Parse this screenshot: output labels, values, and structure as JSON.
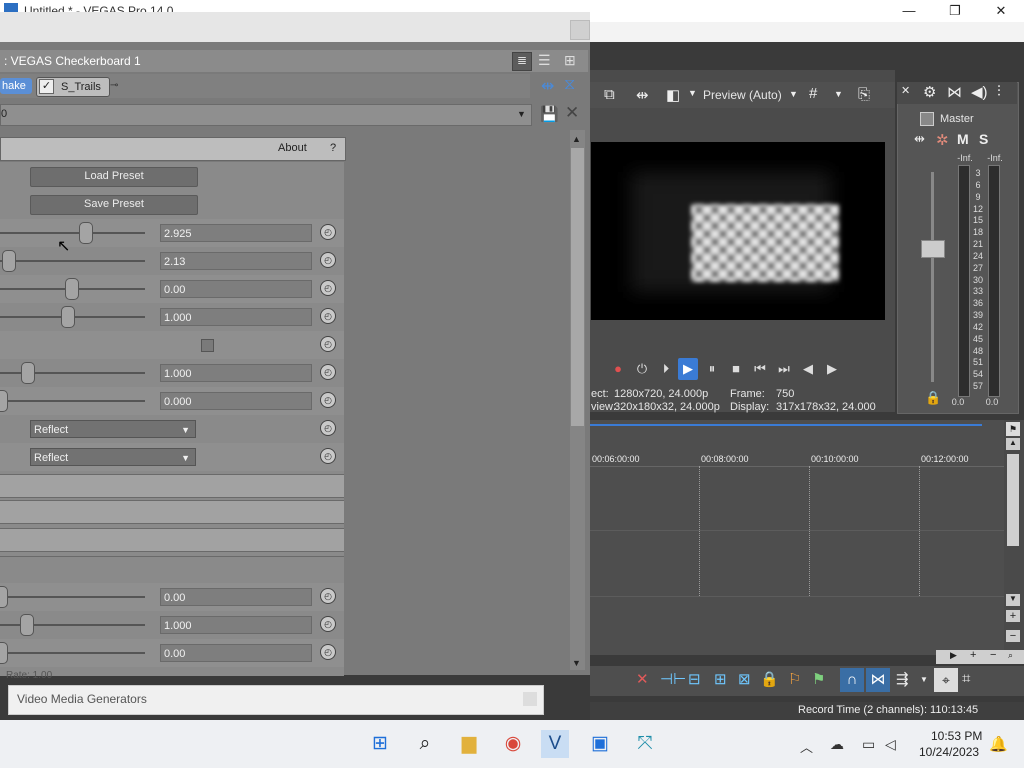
{
  "window": {
    "title": "Untitled * - VEGAS Pro 14.0",
    "minimize": "—",
    "maximize": "❐",
    "close": "✕"
  },
  "dialog": {
    "plugin_name": ": VEGAS Checkerboard 1",
    "chain": [
      "hake",
      "S_Trails"
    ],
    "preset_value": "0",
    "about_label": "About",
    "help_label": "?",
    "load_preset": "Load Preset",
    "save_preset": "Save Preset",
    "params": [
      {
        "value": "2.925"
      },
      {
        "value": "2.13"
      },
      {
        "value": "0.00"
      },
      {
        "value": "1.000"
      },
      {
        "value": ""
      },
      {
        "value": "1.000"
      },
      {
        "value": "0.000"
      },
      {
        "dropdown": "Reflect"
      },
      {
        "dropdown": "Reflect"
      }
    ],
    "params2": [
      {
        "value": "0.00"
      },
      {
        "value": "1.000"
      },
      {
        "value": "0.00"
      }
    ],
    "rate_label": "Rate: 1.00"
  },
  "preview": {
    "mode": "Preview (Auto)",
    "project_label": "ect:",
    "project_value": "1280x720, 24.000p",
    "preview_label": "view:",
    "preview_value": "320x180x32, 24.000p",
    "frame_label": "Frame:",
    "frame_value": "750",
    "display_label": "Display:",
    "display_value": "317x178x32, 24.000"
  },
  "mixer": {
    "title": "Master",
    "m": "M",
    "s": "S",
    "inf_l": "-Inf.",
    "inf_r": "-Inf.",
    "scale": [
      "3",
      "6",
      "9",
      "12",
      "15",
      "18",
      "21",
      "24",
      "27",
      "30",
      "33",
      "36",
      "39",
      "42",
      "45",
      "48",
      "51",
      "54",
      "57"
    ],
    "bottom_l": "0.0",
    "bottom_r": "0.0"
  },
  "timeline": {
    "ticks": [
      "00:06:00:00",
      "00:08:00:00",
      "00:10:00:00",
      "00:12:00:00"
    ]
  },
  "status": {
    "record_time": "Record Time (2 channels): 110:13:45"
  },
  "docked_tab": {
    "label": "Video Media Generators"
  },
  "taskbar": {
    "time": "10:53 PM",
    "date": "10/24/2023"
  },
  "colors": {
    "accent": "#3a7bd5",
    "play_active": "#3a7bd5"
  }
}
